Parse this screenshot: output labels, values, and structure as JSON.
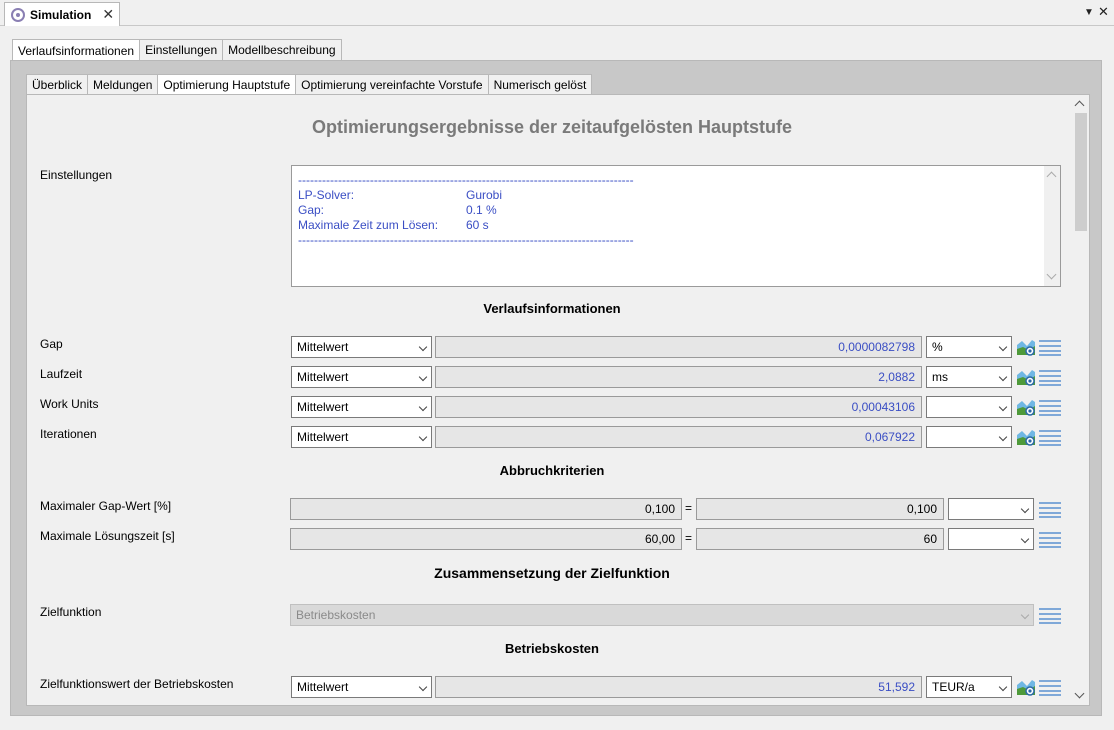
{
  "window": {
    "tab_title": "Simulation",
    "pin_glyph": "▼",
    "close_glyph": "✕"
  },
  "main_tabs": [
    "Verlaufsinformationen",
    "Einstellungen",
    "Modellbeschreibung"
  ],
  "sub_tabs": [
    "Überblick",
    "Meldungen",
    "Optimierung Hauptstufe",
    "Optimierung vereinfachte Vorstufe",
    "Numerisch gelöst"
  ],
  "title": "Optimierungsergebnisse der zeitaufgelösten Hauptstufe",
  "einstellungen": {
    "label": "Einstellungen",
    "separator": "------------------------------------------------------------------------------------",
    "rows": [
      {
        "key": "LP-Solver:",
        "value": "Gurobi"
      },
      {
        "key": "Gap:",
        "value": "0.1 %"
      },
      {
        "key": "Maximale Zeit zum Lösen:",
        "value": "60 s"
      }
    ]
  },
  "verlauf": {
    "heading": "Verlaufsinformationen",
    "rows": [
      {
        "label": "Gap",
        "mode": "Mittelwert",
        "value": "0,0000082798",
        "unit": "%"
      },
      {
        "label": "Laufzeit",
        "mode": "Mittelwert",
        "value": "2,0882",
        "unit": "ms"
      },
      {
        "label": "Work Units",
        "mode": "Mittelwert",
        "value": "0,00043106",
        "unit": ""
      },
      {
        "label": "Iterationen",
        "mode": "Mittelwert",
        "value": "0,067922",
        "unit": ""
      }
    ]
  },
  "abbruch": {
    "heading": "Abbruchkriterien",
    "rows": [
      {
        "label": "Maximaler Gap-Wert [%]",
        "value": "0,100",
        "eq": "=",
        "result": "0,100",
        "unit": ""
      },
      {
        "label": "Maximale Lösungszeit [s]",
        "value": "60,00",
        "eq": "=",
        "result": "60",
        "unit": ""
      }
    ]
  },
  "zusammensetzung": {
    "heading": "Zusammensetzung der Zielfunktion",
    "label": "Zielfunktion",
    "value": "Betriebskosten"
  },
  "betriebskosten": {
    "heading": "Betriebskosten",
    "label": "Zielfunktionswert der Betriebskosten",
    "mode": "Mittelwert",
    "value": "51,592",
    "unit": "TEUR/a"
  },
  "colors": {
    "value_blue": "#3a4ec4",
    "title_gray": "#7a7a7a",
    "icon_blue": "#7fa8d8"
  },
  "icons": [
    "gear-icon",
    "close-icon",
    "chart-icon",
    "list-icon",
    "chevron-down-icon"
  ]
}
